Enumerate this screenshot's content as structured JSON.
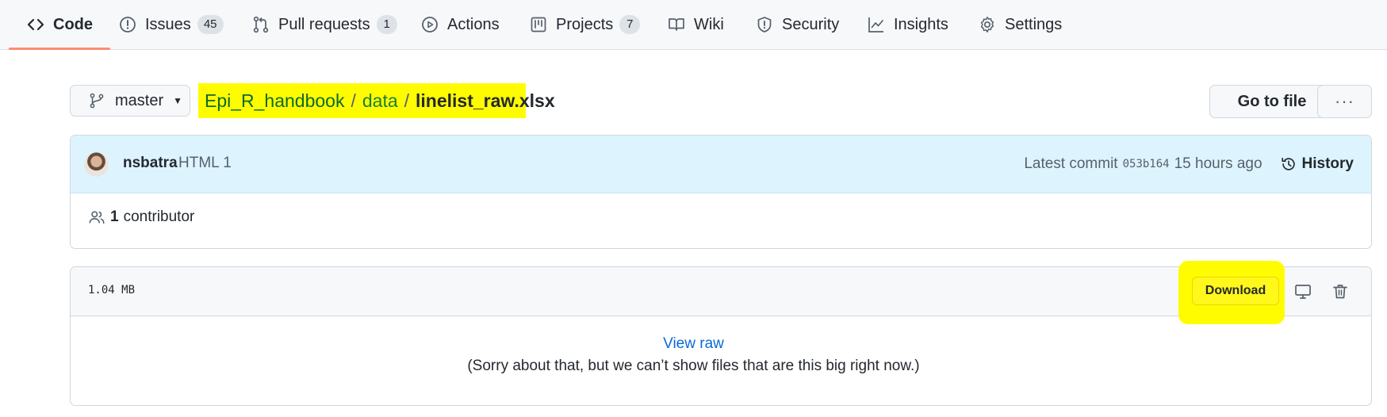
{
  "nav": {
    "tabs": [
      {
        "label": "Code",
        "icon": "code-icon"
      },
      {
        "label": "Issues",
        "count": "45",
        "icon": "issue-icon"
      },
      {
        "label": "Pull requests",
        "count": "1",
        "icon": "pull-request-icon"
      },
      {
        "label": "Actions",
        "icon": "play-icon"
      },
      {
        "label": "Projects",
        "count": "7",
        "icon": "project-icon"
      },
      {
        "label": "Wiki",
        "icon": "book-icon"
      },
      {
        "label": "Security",
        "icon": "shield-icon"
      },
      {
        "label": "Insights",
        "icon": "graph-icon"
      },
      {
        "label": "Settings",
        "icon": "gear-icon"
      }
    ]
  },
  "branch": {
    "name": "master"
  },
  "breadcrumb": {
    "repo": "Epi_R_handbook",
    "sep1": "/",
    "folder": "data",
    "sep2": "/",
    "file": "linelist_raw.xlsx"
  },
  "actions": {
    "go_to_file": "Go to file",
    "more": "···"
  },
  "commit": {
    "author": "nsbatra",
    "message": "HTML 1",
    "latest_label": "Latest commit",
    "sha": "053b164",
    "time": "15 hours ago",
    "history_label": "History"
  },
  "contributors": {
    "count": "1",
    "label": "contributor"
  },
  "file": {
    "size": "1.04 MB",
    "download_label": "Download",
    "view_raw": "View raw",
    "too_big_message": "(Sorry about that, but we can’t show files that are this big right now.)"
  },
  "colors": {
    "highlight": "#fffc00",
    "link": "#0969da",
    "tab_underline": "#fd8c73"
  }
}
